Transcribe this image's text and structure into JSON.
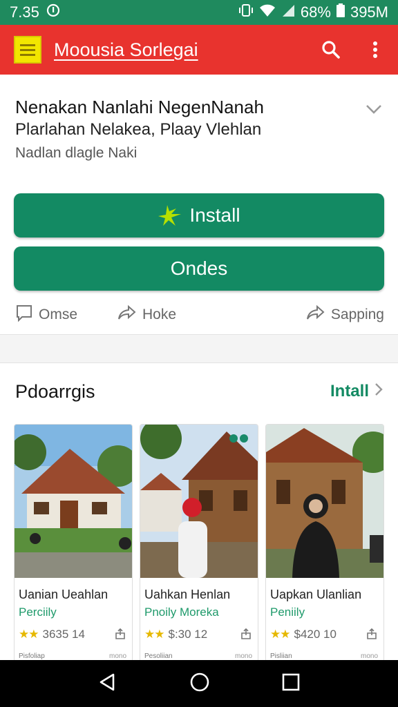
{
  "status_bar": {
    "time": "7.35",
    "battery": "68%",
    "right_text": "395M"
  },
  "app_bar": {
    "title": "Moousia Sorlegai"
  },
  "app": {
    "name": "Nenakan Nanlahi NegenNanah",
    "subtitle": "Plarlahan Nelakea, Plaay Vlehlan",
    "meta": "Nadlan dlagle Naki"
  },
  "buttons": {
    "install": "Install",
    "open": "Ondes"
  },
  "actions": {
    "comment": "Omse",
    "share": "Hoke",
    "sharing": "Sapping"
  },
  "section": {
    "title": "Pdoarrgis",
    "link": "Intall"
  },
  "cards": [
    {
      "title": "Uanian Ueahlan",
      "sub": "Perciily",
      "rating": "3635 14",
      "foot": "Pisfoliap",
      "foot2": "mono"
    },
    {
      "title": "Uahkan Henlan",
      "sub": "Pnoily Moreka",
      "rating": "$:30 12",
      "foot": "Pesoliian",
      "foot2": "mono"
    },
    {
      "title": "Uapkan Ulanlian",
      "sub": "Peniily",
      "rating": "$420 10",
      "foot": "Pisliian",
      "foot2": "mono"
    }
  ],
  "colors": {
    "status": "#1f8a5e",
    "app_bar": "#e8332e",
    "accent": "#138a63"
  }
}
